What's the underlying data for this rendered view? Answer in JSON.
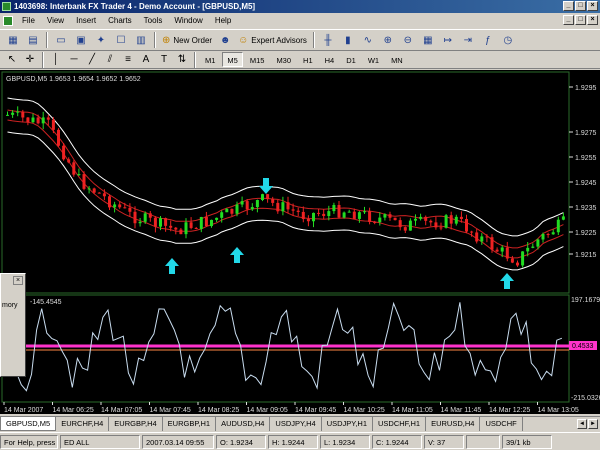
{
  "window": {
    "title": "1403698: Interbank FX Trader 4 - Demo Account - [GBPUSD,M5]",
    "min": "_",
    "max": "□",
    "close": "×"
  },
  "menu": [
    "File",
    "View",
    "Insert",
    "Charts",
    "Tools",
    "Window",
    "Help"
  ],
  "toolbar": {
    "new_order": "New Order",
    "expert_advisors": "Expert Advisors"
  },
  "tools": [
    "A",
    "T"
  ],
  "timeframes": [
    "M1",
    "M5",
    "M15",
    "M30",
    "H1",
    "H4",
    "D1",
    "W1",
    "MN"
  ],
  "active_timeframe": "M5",
  "chart": {
    "header": "GBPUSD,M5  1.9653 1.9654 1.9652 1.9652",
    "indicator_header": "-145.4545",
    "price_ticks": [
      "1.9295",
      "1.9275",
      "1.9255",
      "1.9245",
      "1.9235",
      "1.9225",
      "1.9215"
    ],
    "indicator_ticks": [
      "197.1679",
      "-215.0326"
    ],
    "indicator_marker": "0.4533",
    "time_ticks": [
      "14 Mar 2007",
      "14 Mar 06:25",
      "14 Mar 07:05",
      "14 Mar 07:45",
      "14 Mar 08:25",
      "14 Mar 09:05",
      "14 Mar 09:45",
      "14 Mar 10:25",
      "14 Mar 11:05",
      "14 Mar 11:45",
      "14 Mar 12:25",
      "14 Mar 13:05"
    ],
    "colors": {
      "bull": "#22dd22",
      "bear": "#ee2222",
      "band": "#ffffff",
      "ma": "#cc2222",
      "arrow": "#22d8e8",
      "cci": "#c8dcef",
      "level": "#ff33cc"
    }
  },
  "side_panel": {
    "label": "mory",
    "close": "×"
  },
  "chart_tabs": [
    "GBPUSD,M5",
    "EURCHF,H4",
    "EURGBP,H4",
    "EURGBP,H1",
    "AUDUSD,H4",
    "USDJPY,H4",
    "USDJPY,H1",
    "USDCHF,H1",
    "EURUSD,H4",
    "USDCHF"
  ],
  "active_tab": "GBPUSD,M5",
  "status": {
    "help": "For Help, press",
    "profile": "ED ALL",
    "datetime": "2007.03.14 09:55",
    "open": "O: 1.9234",
    "high": "H: 1.9244",
    "low": "L: 1.9234",
    "close": "C: 1.9244",
    "volume": "V: 37",
    "traffic": "39/1 kb"
  }
}
